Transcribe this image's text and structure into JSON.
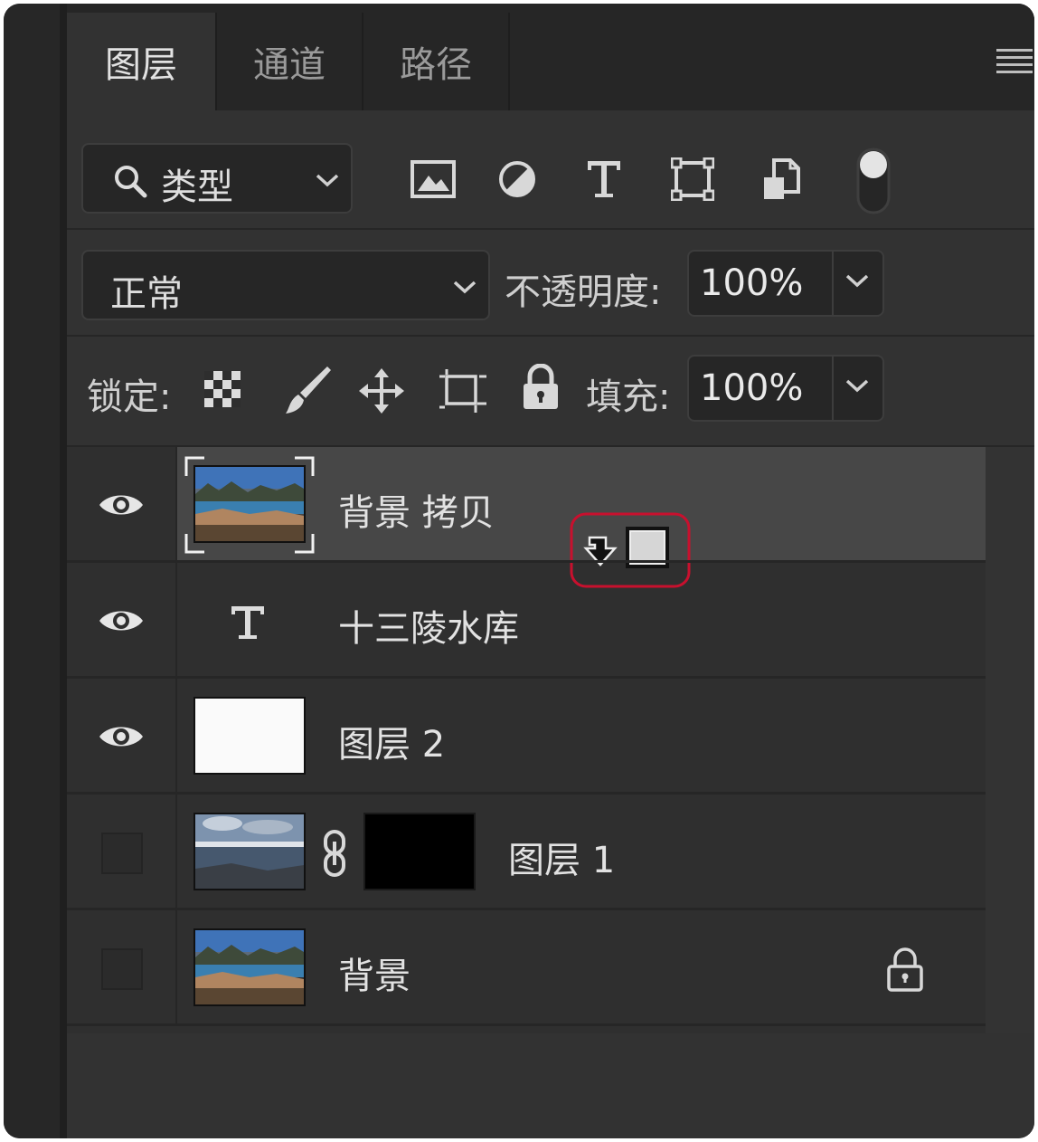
{
  "tabs": [
    {
      "label": "图层",
      "active": true
    },
    {
      "label": "通道",
      "active": false
    },
    {
      "label": "路径",
      "active": false
    }
  ],
  "panel_menu": {
    "icon": "hamburger-menu-icon"
  },
  "filter": {
    "type_label": "类型",
    "icons": [
      "search-icon",
      "chevron-down-icon",
      "image-filter-icon",
      "adjustment-filter-icon",
      "type-filter-icon",
      "shape-filter-icon",
      "smart-object-filter-icon",
      "filter-toggle-icon"
    ]
  },
  "blend": {
    "mode": "正常",
    "opacity_label": "不透明度:",
    "opacity_value": "100%"
  },
  "lock": {
    "label": "锁定:",
    "icons": [
      "lock-transparent-pixels-icon",
      "lock-image-pixels-icon",
      "lock-position-icon",
      "lock-artboard-icon",
      "lock-all-icon"
    ],
    "fill_label": "填充:",
    "fill_value": "100%"
  },
  "layers": [
    {
      "name": "背景 拷贝",
      "visible": true,
      "type": "image",
      "selected": true,
      "badge": "clipping-mask-cursor-icon"
    },
    {
      "name": "十三陵水库",
      "visible": true,
      "type": "text"
    },
    {
      "name": "图层 2",
      "visible": true,
      "type": "fill-white"
    },
    {
      "name": "图层 1",
      "visible": false,
      "type": "image-with-mask"
    },
    {
      "name": "背景",
      "visible": false,
      "type": "image",
      "locked": true
    }
  ],
  "colors": {
    "panel_bg": "#323232",
    "selected_row": "#474747",
    "highlight_ring": "#c8102e"
  }
}
